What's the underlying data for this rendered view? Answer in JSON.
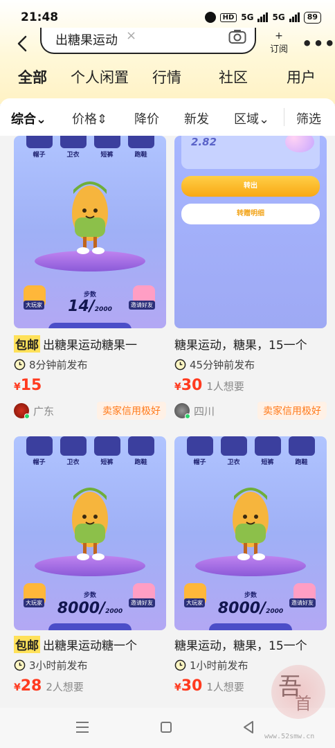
{
  "status_bar": {
    "time": "21:48",
    "hd": "HD",
    "net1": "5G",
    "net2": "5G",
    "battery": "89"
  },
  "search": {
    "query": "出糖果运动",
    "clear": "×",
    "subscribe_plus": "+",
    "subscribe_label": "订阅",
    "more": "•••"
  },
  "category_tabs": [
    {
      "label": "全部",
      "active": true
    },
    {
      "label": "个人闲置"
    },
    {
      "label": "行情"
    },
    {
      "label": "社区"
    },
    {
      "label": "用户"
    }
  ],
  "filters": [
    {
      "label": "综合",
      "arrow": "⌄",
      "active": true
    },
    {
      "label": "价格",
      "arrow": "⇕"
    },
    {
      "label": "降价"
    },
    {
      "label": "新发"
    },
    {
      "label": "区域",
      "arrow": "⌄"
    },
    {
      "label": "筛选"
    }
  ],
  "game_ui": {
    "tabs": [
      "帽子",
      "卫衣",
      "短裤",
      "跑鞋"
    ],
    "steps_label": "步数",
    "left_button": "大玩家",
    "right_button": "邀请好友",
    "transfer_button": "转出",
    "detail_button": "转赠明细"
  },
  "listings": [
    {
      "free_shipping": "包邮",
      "title": "出糖果运动糖果一",
      "time": "8分钟前发布",
      "currency": "¥",
      "price": "15",
      "wants": "",
      "region": "广东",
      "credit": "卖家信用极好",
      "steps_value": "14/",
      "steps_total": "2000"
    },
    {
      "free_shipping": "",
      "title": "糖果运动，糖果，15一个",
      "time": "45分钟前发布",
      "currency": "¥",
      "price": "30",
      "wants": "1人想要",
      "region": "四川",
      "credit": "卖家信用极好",
      "amount": "2.82"
    },
    {
      "free_shipping": "包邮",
      "title": "出糖果运动糖一个",
      "time": "3小时前发布",
      "currency": "¥",
      "price": "28",
      "wants": "2人想要",
      "steps_value": "8000/",
      "steps_total": "2000"
    },
    {
      "free_shipping": "",
      "title": "糖果运动，糖果，15一个",
      "time": "1小时前发布",
      "currency": "¥",
      "price": "30",
      "wants": "1人想要",
      "steps_value": "8000/",
      "steps_total": "2000"
    }
  ],
  "watermark": {
    "url": "www.52smw.cn",
    "char1": "吾",
    "char2": "首"
  },
  "colors": {
    "accent_yellow": "#ffe15a",
    "price_red": "#ff3a1f",
    "credit_orange": "#ff7a1a"
  }
}
